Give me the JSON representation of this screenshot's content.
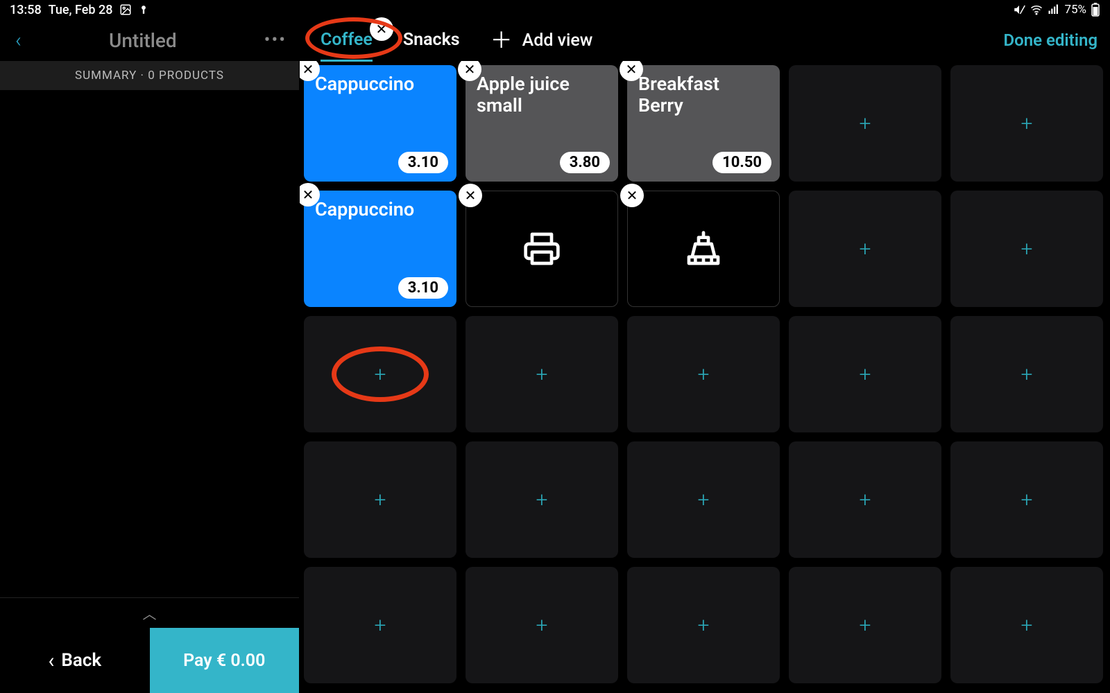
{
  "status_bar": {
    "time": "13:58",
    "date": "Tue, Feb 28",
    "battery": "75%"
  },
  "sidebar": {
    "title": "Untitled",
    "summary": "SUMMARY · 0 PRODUCTS",
    "back_label": "Back",
    "pay_label": "Pay € 0.00"
  },
  "tabs": {
    "items": [
      {
        "label": "Coffee",
        "active": true,
        "closable": true
      },
      {
        "label": "Snacks",
        "active": false,
        "closable": false
      }
    ],
    "add_view_label": "Add view",
    "done_label": "Done editing"
  },
  "grid": {
    "rows": 5,
    "cols": 5,
    "cells": [
      {
        "type": "product",
        "color": "blue",
        "name": "Cappuccino",
        "price": "3.10",
        "removable": true
      },
      {
        "type": "product",
        "color": "grey",
        "name": "Apple juice small",
        "price": "3.80",
        "removable": true
      },
      {
        "type": "product",
        "color": "grey",
        "name": "Breakfast Berry",
        "price": "10.50",
        "removable": true
      },
      {
        "type": "empty"
      },
      {
        "type": "empty"
      },
      {
        "type": "product",
        "color": "blue",
        "name": "Cappuccino",
        "price": "3.10",
        "removable": true
      },
      {
        "type": "icon",
        "icon": "printer",
        "removable": true
      },
      {
        "type": "icon",
        "icon": "register",
        "removable": true
      },
      {
        "type": "empty"
      },
      {
        "type": "empty"
      },
      {
        "type": "empty",
        "annotated": true
      },
      {
        "type": "empty"
      },
      {
        "type": "empty"
      },
      {
        "type": "empty"
      },
      {
        "type": "empty"
      },
      {
        "type": "empty"
      },
      {
        "type": "empty"
      },
      {
        "type": "empty"
      },
      {
        "type": "empty"
      },
      {
        "type": "empty"
      },
      {
        "type": "empty"
      },
      {
        "type": "empty"
      },
      {
        "type": "empty"
      },
      {
        "type": "empty"
      },
      {
        "type": "empty"
      }
    ]
  }
}
